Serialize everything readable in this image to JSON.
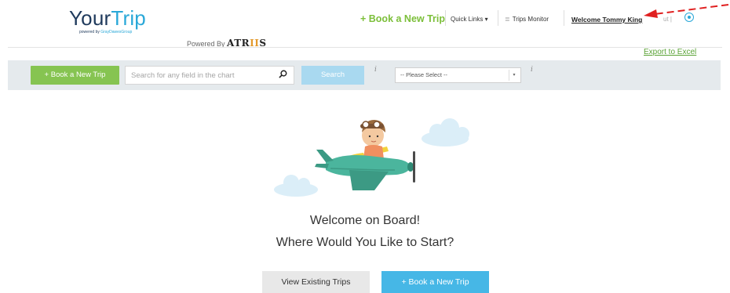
{
  "brand": {
    "logo_part1": "Your",
    "logo_part2": "Trip",
    "logo_sub_prefix": "powered by ",
    "logo_sub_brand": "GrayDawesGroup",
    "powered_by_label": "Powered By",
    "atriis_part1": "ATR",
    "atriis_part2": "II",
    "atriis_part3": "S"
  },
  "nav": {
    "book_label": "+ Book a New Trip",
    "quick_links_label": "Quick Links ▾",
    "trips_monitor_icon": "≣",
    "trips_monitor_label": "Trips Monitor",
    "welcome_label": "Welcome Tommy King",
    "logout_label": "ut |",
    "settings_icon": "gear-icon"
  },
  "export_label": "Export to Excel",
  "toolbar": {
    "book_label": "+ Book a New Trip",
    "search_placeholder": "Search for any field in the chart",
    "search_button_label": "Search",
    "info_icon_1": "i",
    "select_value": "-- Please Select --",
    "info_icon_2": "i"
  },
  "hero": {
    "title_line1": "Welcome on Board!",
    "title_line2": "Where Would You Like to Start?",
    "view_trips_label": "View Existing Trips",
    "book_label": "+ Book a New Trip"
  },
  "colors": {
    "brand_dark": "#1f3a5c",
    "brand_blue": "#2aa8d8",
    "green": "#86c451",
    "light_blue": "#a9d9f0",
    "cta_blue": "#46b7e6",
    "annotation_red": "#e02020"
  }
}
